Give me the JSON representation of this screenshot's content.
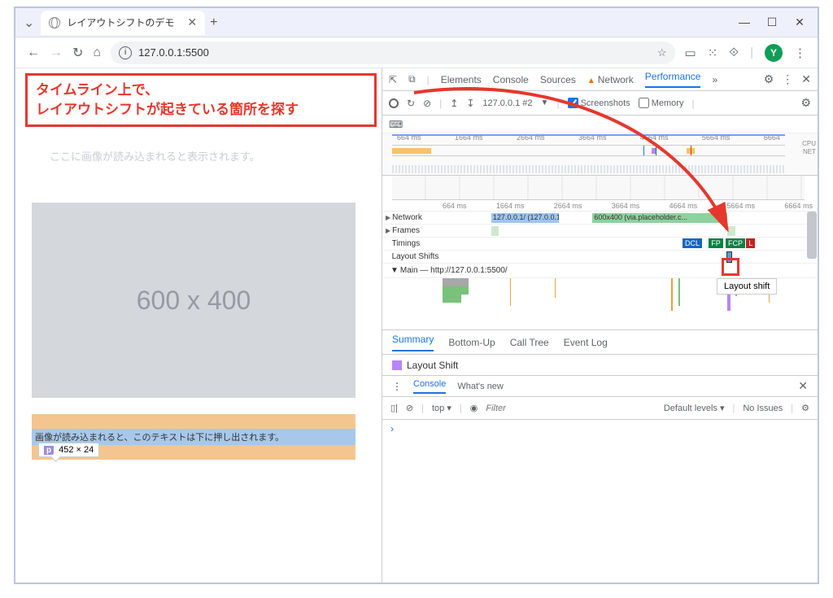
{
  "tab": {
    "title": "レイアウトシフトのデモ"
  },
  "window": {
    "min": "—",
    "max": "☐",
    "close": "✕"
  },
  "nav": {
    "back": "←",
    "fwd": "→",
    "reload": "↻",
    "home": "⌂"
  },
  "address": {
    "info": "i",
    "url": "127.0.0.1:5500",
    "star": "☆"
  },
  "toolbar_icons": {
    "ext": "▭",
    "puzzle": "⁙",
    "dev": "⟐",
    "avatar": "Y",
    "menu": "⋮"
  },
  "page": {
    "heading": "レイアウトシフトのデモ",
    "ghost": "ここに画像が読み込まれると表示されます。",
    "callout_line1": "タイムライン上で、",
    "callout_line2": "レイアウトシフトが起きている箇所を探す",
    "placeholder": "600 x 400",
    "pushed_text": "画像が読み込まれると、このテキストは下に押し出されます。",
    "badge_tag": "p",
    "badge_dims": "452 × 24"
  },
  "devtools": {
    "tabs": {
      "inspect": "⇱",
      "device": "⧉",
      "elements": "Elements",
      "console": "Console",
      "sources": "Sources",
      "network": "Network",
      "performance": "Performance",
      "more": "»",
      "gear": "⚙",
      "menu": "⋮",
      "close": "✕"
    },
    "rec_toolbar": {
      "reload": "↻",
      "clear": "⊘",
      "up": "↥",
      "down": "↧",
      "session": "127.0.0.1 #2",
      "dd": "▼",
      "screenshots": "Screenshots",
      "memory": "Memory"
    },
    "keyboard": "⌨",
    "overview_ticks": [
      "664 ms",
      "1664 ms",
      "2664 ms",
      "3664 ms",
      "4664 ms",
      "5664 ms",
      "6664"
    ],
    "overview_labels": [
      "CPU",
      "NET"
    ],
    "ruler_ticks": [
      "664 ms",
      "1664 ms",
      "2664 ms",
      "3664 ms",
      "4664 ms",
      "5664 ms",
      "6664 ms"
    ],
    "tracks": {
      "network": "Network",
      "frames": "Frames",
      "timings": "Timings",
      "layout_shifts": "Layout Shifts",
      "main": "Main — http://127.0.0.1:5500/"
    },
    "network_item1": "127.0.0.1/ (127.0.0.1)",
    "network_item2": "600x400 (via.placeholder.c...",
    "timing_badges": {
      "dcl": "DCL",
      "fp": "FP",
      "fcp": "FCP",
      "l": "L"
    },
    "tooltip": "Layout shift",
    "summary_tabs": {
      "summary": "Summary",
      "bottom": "Bottom-Up",
      "calltree": "Call Tree",
      "eventlog": "Event Log"
    },
    "summary_label": "Layout Shift",
    "drawer_tabs": {
      "console": "Console",
      "whatsnew": "What's new"
    },
    "console_bar": {
      "side": "▯|",
      "clear": "⊘",
      "top": "top ▾",
      "eye": "◉",
      "filter": "Filter",
      "levels": "Default levels ▾",
      "issues": "No Issues",
      "gear": "⚙"
    },
    "prompt": "›"
  }
}
